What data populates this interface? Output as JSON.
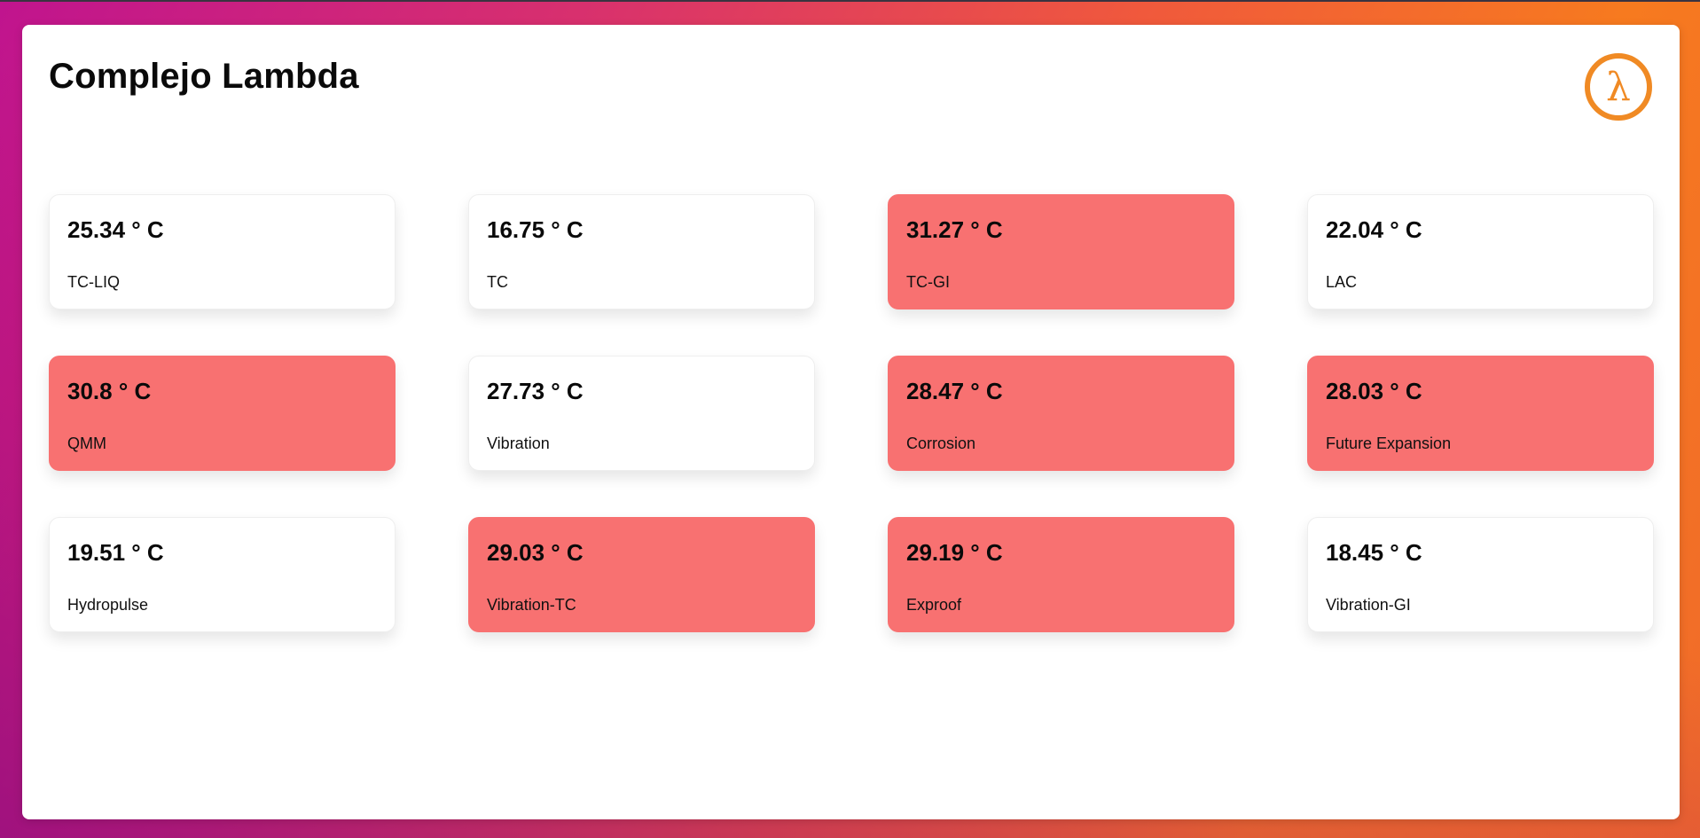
{
  "page": {
    "title": "Complejo Lambda"
  },
  "logo": {
    "icon": "lambda-logo-icon",
    "glyph": "λ",
    "color": "#f08a24"
  },
  "colors": {
    "alert_card": "#f87171",
    "normal_card": "#ffffff"
  },
  "sensors": [
    {
      "value": "25.34 ° C",
      "label": "TC-LIQ",
      "alert": false
    },
    {
      "value": "16.75 ° C",
      "label": "TC",
      "alert": false
    },
    {
      "value": "31.27 ° C",
      "label": "TC-GI",
      "alert": true
    },
    {
      "value": "22.04 ° C",
      "label": "LAC",
      "alert": false
    },
    {
      "value": "30.8 ° C",
      "label": "QMM",
      "alert": true
    },
    {
      "value": "27.73 ° C",
      "label": "Vibration",
      "alert": false
    },
    {
      "value": "28.47 ° C",
      "label": "Corrosion",
      "alert": true
    },
    {
      "value": "28.03 ° C",
      "label": "Future Expansion",
      "alert": true
    },
    {
      "value": "19.51 ° C",
      "label": "Hydropulse",
      "alert": false
    },
    {
      "value": "29.03 ° C",
      "label": "Vibration-TC",
      "alert": true
    },
    {
      "value": "29.19 ° C",
      "label": "Exproof",
      "alert": true
    },
    {
      "value": "18.45 ° C",
      "label": "Vibration-GI",
      "alert": false
    }
  ]
}
